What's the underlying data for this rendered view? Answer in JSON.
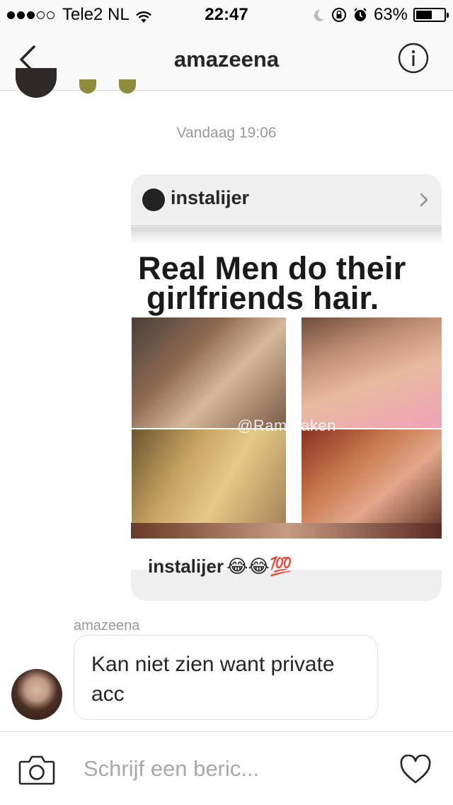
{
  "status_bar": {
    "carrier": "Tele2 NL",
    "time": "22:47",
    "battery_percent": "63%",
    "battery_level": 0.63,
    "signal_dots_filled": 3,
    "signal_dots_total": 5
  },
  "nav": {
    "title": "amazeena"
  },
  "conversation": {
    "timestamp": "Vandaag 19:06",
    "shared_post": {
      "username": "instalijer",
      "image_text_line1": "Real Men do their",
      "image_text_line2": "girlfriends hair.",
      "watermark": "@Ramkraken",
      "caption_user": "instalijer",
      "caption_emojis": "😂😂💯"
    },
    "incoming_message": {
      "sender": "amazeena",
      "text": "Kan niet zien want private acc"
    }
  },
  "composer": {
    "placeholder": "Schrijf een beric..."
  }
}
